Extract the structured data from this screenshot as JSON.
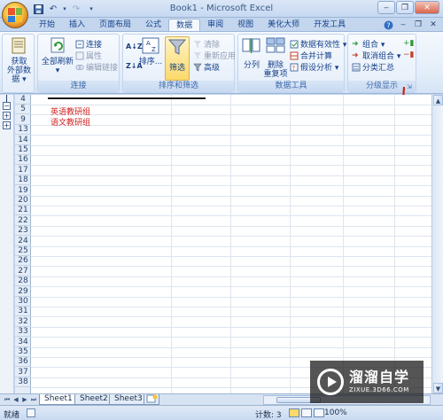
{
  "title_bar": {
    "window_title": "Book1 - Microsoft Excel"
  },
  "quick_access": {
    "items": [
      "save-icon",
      "undo-icon",
      "redo-icon"
    ]
  },
  "tabs": [
    {
      "label": "开始"
    },
    {
      "label": "插入"
    },
    {
      "label": "页面布局"
    },
    {
      "label": "公式"
    },
    {
      "label": "数据",
      "active": true
    },
    {
      "label": "审阅"
    },
    {
      "label": "视图"
    },
    {
      "label": "美化大师"
    },
    {
      "label": "开发工具"
    }
  ],
  "ribbon": {
    "get_external": {
      "line1": "获取",
      "line2": "外部数据 ▾",
      "group_label": ""
    },
    "connections": {
      "refresh_all_line1": "全部刷新",
      "refresh_all_arrow": "▾",
      "connections": "连接",
      "properties": "属性",
      "edit_links": "编辑链接",
      "group_label": "连接"
    },
    "sort_filter": {
      "sort_az": "A↓Z",
      "sort_za": "Z↓A",
      "sort": "排序...",
      "filter": "筛选",
      "clear": "清除",
      "reapply": "重新应用",
      "advanced": "高级",
      "group_label": "排序和筛选"
    },
    "data_tools": {
      "text_to_columns": "分列",
      "remove_dup_line1": "删除",
      "remove_dup_line2": "重复项",
      "data_validation": "数据有效性 ▾",
      "consolidate": "合并计算",
      "what_if": "假设分析 ▾",
      "group_label": "数据工具"
    },
    "outline": {
      "group": "组合 ▾",
      "ungroup": "取消组合 ▾",
      "subtotal": "分类汇总",
      "group_label": "分级显示"
    }
  },
  "grid": {
    "rows": [
      {
        "num": "4",
        "text": "",
        "hidden_top": true
      },
      {
        "num": "5",
        "text": "英语教研组"
      },
      {
        "num": "9",
        "text": "语文教研组"
      },
      {
        "num": "13",
        "text": ""
      },
      {
        "num": "14",
        "text": ""
      },
      {
        "num": "15",
        "text": ""
      },
      {
        "num": "16",
        "text": ""
      },
      {
        "num": "17",
        "text": ""
      },
      {
        "num": "18",
        "text": ""
      },
      {
        "num": "19",
        "text": ""
      },
      {
        "num": "20",
        "text": ""
      },
      {
        "num": "21",
        "text": ""
      },
      {
        "num": "22",
        "text": ""
      },
      {
        "num": "23",
        "text": ""
      },
      {
        "num": "24",
        "text": ""
      },
      {
        "num": "25",
        "text": ""
      },
      {
        "num": "26",
        "text": ""
      },
      {
        "num": "27",
        "text": ""
      },
      {
        "num": "28",
        "text": ""
      },
      {
        "num": "29",
        "text": ""
      },
      {
        "num": "30",
        "text": ""
      },
      {
        "num": "31",
        "text": ""
      },
      {
        "num": "32",
        "text": ""
      },
      {
        "num": "33",
        "text": ""
      },
      {
        "num": "34",
        "text": ""
      },
      {
        "num": "35",
        "text": ""
      },
      {
        "num": "36",
        "text": ""
      },
      {
        "num": "37",
        "text": ""
      },
      {
        "num": "38",
        "text": ""
      }
    ],
    "outline_symbols": [
      "−",
      "+",
      "+"
    ]
  },
  "sheet_tabs": [
    {
      "label": "Sheet1",
      "active": true
    },
    {
      "label": "Sheet2"
    },
    {
      "label": "Sheet3"
    }
  ],
  "status_bar": {
    "mode": "就绪",
    "count": "计数: 3",
    "zoom": "100%"
  },
  "watermark": {
    "title": "溜溜自学",
    "subtitle": "ZIXUE.3D66.COM"
  },
  "colors": {
    "accent": "#15428b",
    "cell_text": "#d42020",
    "filter_highlight": "#fbd96b"
  }
}
